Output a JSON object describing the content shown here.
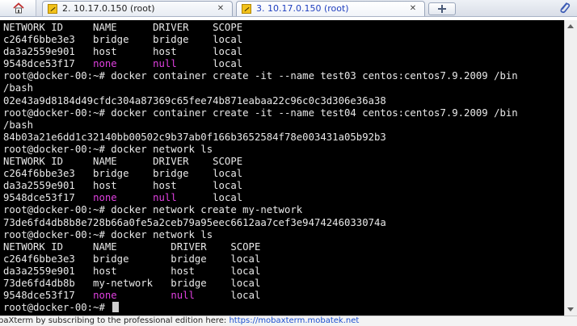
{
  "tabs": [
    {
      "title": "2. 10.17.0.150 (root)",
      "active": false
    },
    {
      "title": "3. 10.17.0.150 (root)",
      "active": true
    }
  ],
  "icons": {
    "home": "home-icon",
    "tab": "terminal-key-icon",
    "close": "close-icon",
    "new_tab": "plus-icon",
    "attach": "paperclip-icon"
  },
  "colors": {
    "terminal_bg": "#000000",
    "terminal_fg": "#e8e8e8",
    "highlight": "#e040e0",
    "link": "#1a4fd0"
  },
  "terminal": {
    "lines": [
      {
        "segs": [
          {
            "t": "NETWORK ID     NAME      DRIVER    SCOPE"
          }
        ]
      },
      {
        "segs": [
          {
            "t": "c264f6bbe3e3   bridge    bridge    local"
          }
        ]
      },
      {
        "segs": [
          {
            "t": "da3a2559e901   host      host      local"
          }
        ]
      },
      {
        "segs": [
          {
            "t": "9548dce53f17   "
          },
          {
            "t": "none",
            "c": "mg"
          },
          {
            "t": "      "
          },
          {
            "t": "null",
            "c": "mg"
          },
          {
            "t": "      local"
          }
        ]
      },
      {
        "segs": [
          {
            "t": "root@docker-00:~# docker container create -it --name test03 centos:centos7.9.2009 /bin"
          }
        ]
      },
      {
        "segs": [
          {
            "t": "/bash"
          }
        ]
      },
      {
        "segs": [
          {
            "t": "02e43a9d8184d49cfdc304a87369c65fee74b871eabaa22c96c0c3d306e36a38"
          }
        ]
      },
      {
        "segs": [
          {
            "t": "root@docker-00:~# docker container create -it --name test04 centos:centos7.9.2009 /bin"
          }
        ]
      },
      {
        "segs": [
          {
            "t": "/bash"
          }
        ]
      },
      {
        "segs": [
          {
            "t": "84b03a21e6dd1c32140bb00502c9b37ab0f166b3652584f78e003431a05b92b3"
          }
        ]
      },
      {
        "segs": [
          {
            "t": "root@docker-00:~# docker network ls"
          }
        ]
      },
      {
        "segs": [
          {
            "t": "NETWORK ID     NAME      DRIVER    SCOPE"
          }
        ]
      },
      {
        "segs": [
          {
            "t": "c264f6bbe3e3   bridge    bridge    local"
          }
        ]
      },
      {
        "segs": [
          {
            "t": "da3a2559e901   host      host      local"
          }
        ]
      },
      {
        "segs": [
          {
            "t": "9548dce53f17   "
          },
          {
            "t": "none",
            "c": "mg"
          },
          {
            "t": "      "
          },
          {
            "t": "null",
            "c": "mg"
          },
          {
            "t": "      local"
          }
        ]
      },
      {
        "segs": [
          {
            "t": "root@docker-00:~# docker network create my-network"
          }
        ]
      },
      {
        "segs": [
          {
            "t": "73de6fd4db8b8e728b66a0fe5a2ceb79a95eec6612aa7cef3e9474246033074a"
          }
        ]
      },
      {
        "segs": [
          {
            "t": "root@docker-00:~# docker network ls"
          }
        ]
      },
      {
        "segs": [
          {
            "t": "NETWORK ID     NAME         DRIVER    SCOPE"
          }
        ]
      },
      {
        "segs": [
          {
            "t": "c264f6bbe3e3   bridge       bridge    local"
          }
        ]
      },
      {
        "segs": [
          {
            "t": "da3a2559e901   host         host      local"
          }
        ]
      },
      {
        "segs": [
          {
            "t": "73de6fd4db8b   my-network   bridge    local"
          }
        ]
      },
      {
        "segs": [
          {
            "t": "9548dce53f17   "
          },
          {
            "t": "none",
            "c": "mg"
          },
          {
            "t": "         "
          },
          {
            "t": "null",
            "c": "mg"
          },
          {
            "t": "      local"
          }
        ]
      },
      {
        "segs": [
          {
            "t": "root@docker-00:~# "
          }
        ],
        "cursor": true
      }
    ]
  },
  "statusbar": {
    "promo": "baXterm by subscribing to the professional edition here: ",
    "link": "https://mobaxterm.mobatek.net"
  }
}
